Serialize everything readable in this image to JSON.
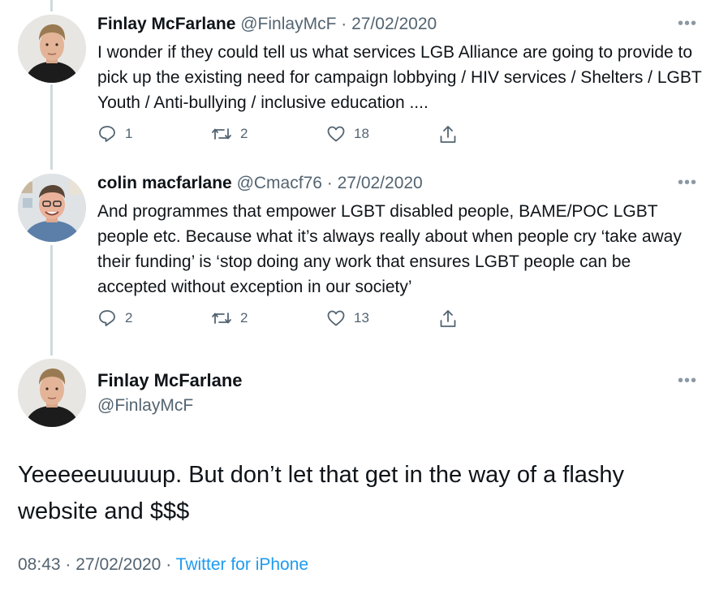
{
  "tweets": [
    {
      "name": "Finlay McFarlane",
      "handle": "@FinlayMcF",
      "separator": "·",
      "date": "27/02/2020",
      "text": "I wonder if they could tell us what services LGB Alliance are going to provide to pick up the existing need for campaign lobbying / HIV services / Shelters / LGBT Youth / Anti-bullying / inclusive education ....",
      "replies": "1",
      "retweets": "2",
      "likes": "18"
    },
    {
      "name": "colin macfarlane",
      "handle": "@Cmacf76",
      "separator": "·",
      "date": "27/02/2020",
      "text": "And programmes that empower LGBT disabled people, BAME/POC LGBT people etc. Because what it’s always really about when people cry ‘take away their funding’ is ‘stop doing any work that ensures LGBT people can be accepted without exception in our society’",
      "replies": "2",
      "retweets": "2",
      "likes": "13"
    }
  ],
  "main_tweet": {
    "name": "Finlay McFarlane",
    "handle": "@FinlayMcF",
    "text": "Yeeeeeuuuuup. But don’t let that get in the way of a flashy website and $$$",
    "time": "08:43",
    "separator": "·",
    "date": "27/02/2020",
    "separator2": "·",
    "source": "Twitter for iPhone"
  },
  "more_label": "•••",
  "icons": {
    "reply": "reply-icon",
    "retweet": "retweet-icon",
    "like": "heart-icon",
    "share": "share-icon",
    "more": "more-icon"
  },
  "colors": {
    "text": "#0f1419",
    "secondary": "#536471",
    "link": "#1d9bf0",
    "thread_line": "#cfd9de"
  }
}
